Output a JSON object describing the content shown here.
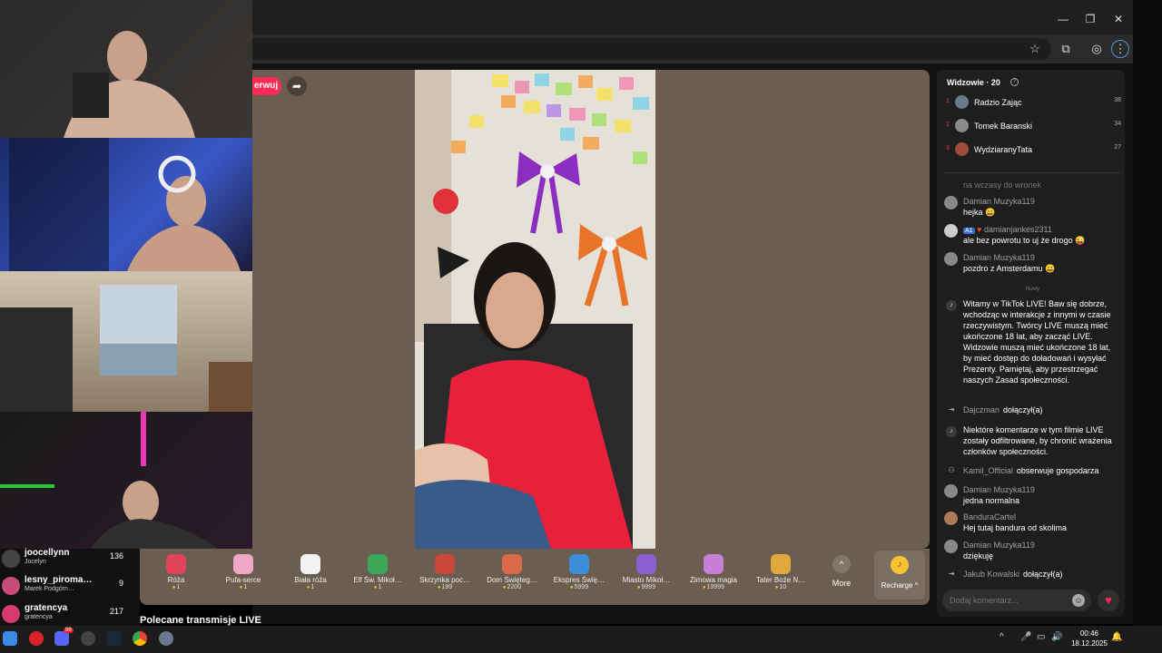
{
  "browser": {
    "minimize": "—",
    "restore": "❐",
    "close": "✕",
    "icons": [
      "star-icon",
      "extensions-icon",
      "profile-icon",
      "menu-icon"
    ]
  },
  "stage": {
    "follow_label": "erwuj",
    "share_icon": "share-icon"
  },
  "gifts": [
    {
      "name": "Róża",
      "price": "1",
      "color": "#e0425a"
    },
    {
      "name": "Pufa-serce",
      "price": "1",
      "color": "#f2a7c7"
    },
    {
      "name": "Biała róża",
      "price": "1",
      "color": "#f2f2f2"
    },
    {
      "name": "Elf Św. Mikoł…",
      "price": "1",
      "color": "#3aa65a"
    },
    {
      "name": "Skrzynka poc…",
      "price": "199",
      "color": "#c8473a"
    },
    {
      "name": "Dom Święteg…",
      "price": "2200",
      "color": "#d86a4a"
    },
    {
      "name": "Ekspres Świę…",
      "price": "5999",
      "color": "#3c8fd6"
    },
    {
      "name": "Miasto Mikoł…",
      "price": "9999",
      "color": "#8a5fd0"
    },
    {
      "name": "Zimowa magia",
      "price": "19999",
      "color": "#c87fd8"
    },
    {
      "name": "Tater Boże N…",
      "price": "10",
      "color": "#e0a83a"
    }
  ],
  "more_label": "More",
  "recharge_label": "Recharge ^",
  "recommended_label": "Polecane transmisje LIVE",
  "viewers": {
    "title": "Widzowie · 20",
    "list": [
      {
        "rank": "1",
        "name": "Radzio Zając",
        "score": "38"
      },
      {
        "rank": "2",
        "name": "Tomek Baranski",
        "score": "34"
      },
      {
        "rank": "3",
        "name": "WydziaranyTata",
        "score": "27"
      }
    ]
  },
  "chat": {
    "faded_text": "na wczasy do wronek",
    "messages": [
      {
        "user": "Damian Muzyka119",
        "text": "hejka 😀"
      },
      {
        "user": "damianjankes2311",
        "text": "ale bez powrotu to uj że drogo 😜",
        "badge": "A1"
      },
      {
        "user": "Damian Muzyka119",
        "text": "pozdro z Amsterdamu 😀"
      }
    ],
    "new_label": "Nowy",
    "welcome": "Witamy w TikTok LIVE! Baw się dobrze, wchodząc w interakcje z innymi w czasie rzeczywistym. Twórcy LIVE muszą mieć ukończone 18 lat, aby zacząć LIVE. Widzowie muszą mieć ukończone 18 lat, by mieć dostęp do doładowań i wysyłać Prezenty. Pamiętaj, aby przestrzegać naszych Zasad społeczności.",
    "join1": {
      "user": "Dajczman",
      "action": "dołączył(a)"
    },
    "filtered": "Niektóre komentarze w tym filmie LIVE zostały odfiltrowane, by chronić wrażenia członków społeczności.",
    "follow": {
      "user": "Kamil_Official",
      "action": "obserwuje gospodarza"
    },
    "messages2": [
      {
        "user": "Damian Muzyka119",
        "text": "jedna normalna"
      },
      {
        "user": "BanduraCartel",
        "text": "Hej tutaj bandura od skolima"
      },
      {
        "user": "Damian Muzyka119",
        "text": "dziękuję"
      }
    ],
    "join2": {
      "user": "Jakub Kowalski",
      "action": "dołączył(a)"
    },
    "input_placeholder": "Dodaj komentarz..."
  },
  "ranking": [
    {
      "name": "joocellynn",
      "sub": "Jocelyn",
      "score": "136"
    },
    {
      "name": "lesny_piroma…",
      "sub": "Marek Podgórn…",
      "score": "9"
    },
    {
      "name": "gratencya",
      "sub": "gratencya",
      "score": "217"
    }
  ],
  "taskbar": {
    "time": "00:46",
    "date": "18.12.2025",
    "badge": "99"
  }
}
